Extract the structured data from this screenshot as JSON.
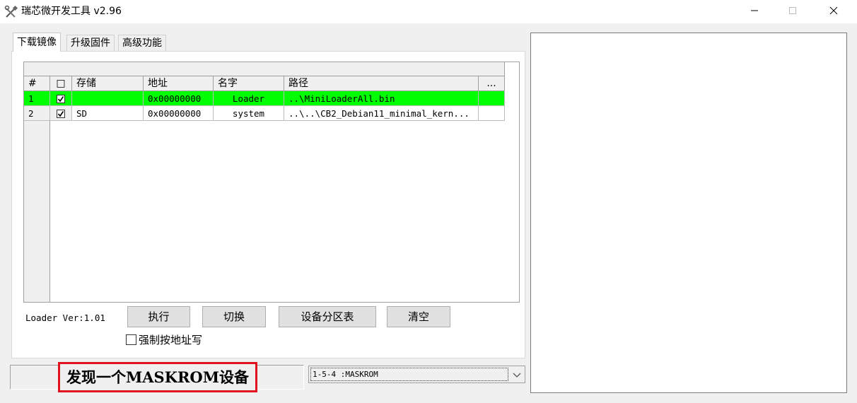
{
  "window": {
    "title": "瑞芯微开发工具 v2.96",
    "icon": "tools-icon",
    "controls": [
      "minimize-icon",
      "maximize-icon",
      "close-icon"
    ]
  },
  "tabs": [
    {
      "label": "下载镜像",
      "active": true
    },
    {
      "label": "升级固件",
      "active": false
    },
    {
      "label": "高级功能",
      "active": false
    }
  ],
  "table": {
    "columns": [
      "#",
      "□",
      "存储",
      "地址",
      "名字",
      "路径",
      "..."
    ],
    "rows": [
      {
        "num": "1",
        "checked": true,
        "storage": "",
        "address": "0x00000000",
        "name": "Loader",
        "path": "..\\MiniLoaderAll.bin",
        "selected": true
      },
      {
        "num": "2",
        "checked": true,
        "storage": "SD",
        "address": "0x00000000",
        "name": "system",
        "path": "..\\..\\CB2_Debian11_minimal_kern...",
        "selected": false
      }
    ]
  },
  "loader_version": "Loader Ver:1.01",
  "buttons": {
    "execute": "执行",
    "switch": "切换",
    "partition_table": "设备分区表",
    "clear": "清空"
  },
  "force_write": {
    "label": "强制按地址写",
    "checked": false
  },
  "status": {
    "message": "发现一个MASKROM设备"
  },
  "device_select": {
    "value": "1-5-4 :MASKROM"
  },
  "colors": {
    "selected_row": "#00ff00",
    "status_border": "#e0141e"
  }
}
